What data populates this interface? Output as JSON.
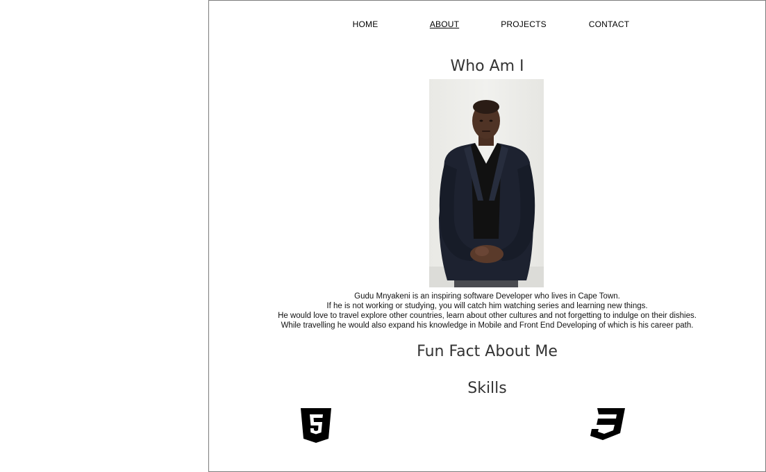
{
  "nav": {
    "items": [
      {
        "label": "HOME",
        "active": false
      },
      {
        "label": "ABOUT",
        "active": true
      },
      {
        "label": "PROJECTS",
        "active": false
      },
      {
        "label": "CONTACT",
        "active": false
      }
    ]
  },
  "about": {
    "title": "Who Am I",
    "bio_lines": [
      "Gudu Mnyakeni is an inspiring software Developer who lives in Cape Town.",
      "If he is not working or studying, you will catch him watching series and learning new things.",
      "He would love to travel explore other countries, learn about other cultures and not forgetting to indulge on their dishies.",
      "While travelling he would also expand his knowledge in Mobile and Front End Developing of which is his career path."
    ]
  },
  "fun_fact": {
    "title": "Fun Fact About Me"
  },
  "skills": {
    "title": "Skills",
    "icons": [
      "html5-icon",
      "css3-icon"
    ]
  },
  "colors": {
    "text": "#333333",
    "border": "#7a7a7a",
    "icon": "#000000"
  }
}
